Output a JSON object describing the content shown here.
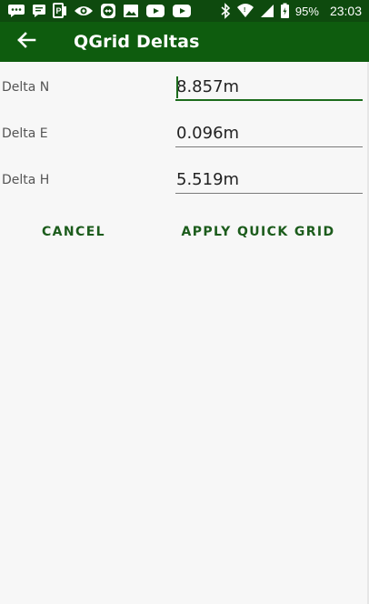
{
  "status_bar": {
    "battery_percent": "95%",
    "time": "23:03",
    "icons_left": [
      "chat-bubble-icon",
      "message-icon",
      "parking-icon",
      "eye-icon",
      "teamviewer-icon",
      "image-icon",
      "youtube-icon",
      "youtube-icon"
    ],
    "icons_right": [
      "bluetooth-icon",
      "wifi-icon",
      "signal-icon",
      "battery-icon"
    ]
  },
  "app_bar": {
    "title": "QGrid Deltas",
    "back_icon": "arrow-left-icon",
    "color": "#0e5c0e"
  },
  "fields": [
    {
      "label": "Delta N",
      "value": "8.857m",
      "focused": true
    },
    {
      "label": "Delta E",
      "value": "0.096m",
      "focused": false
    },
    {
      "label": "Delta H",
      "value": "5.519m",
      "focused": false
    }
  ],
  "actions": {
    "cancel_label": "CANCEL",
    "apply_label": "APPLY QUICK GRID"
  },
  "colors": {
    "accent": "#1c6b1c",
    "status_bar": "#0e4a0e",
    "background": "#f7f7f7"
  }
}
